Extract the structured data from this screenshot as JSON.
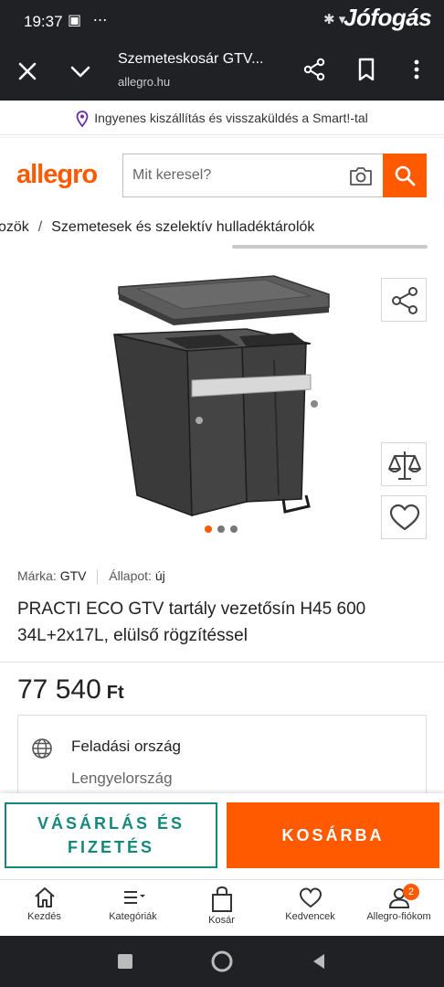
{
  "status_bar": {
    "time": "19:37",
    "left_icons": "▣ ⋯",
    "right_icons": "✱ ▾",
    "watermark": "Jófogás"
  },
  "browser": {
    "title": "Szemeteskosár GTV...",
    "url": "allegro.hu"
  },
  "promo": {
    "text": "Ingyenes kiszállítás és visszaküldés a Smart!-tal"
  },
  "header": {
    "logo": "allegro",
    "search_placeholder": "Mit keresel?"
  },
  "breadcrumb": {
    "items": [
      "ozök",
      "Szemetesek és szelektív hulladéktárolók"
    ]
  },
  "gallery": {
    "image_count": 3,
    "active_index": 0
  },
  "product": {
    "brand_label": "Márka:",
    "brand_value": "GTV",
    "condition_label": "Állapot:",
    "condition_value": "új",
    "title": "PRACTI ECO GTV tartály vezetősín H45 600 34L+2x17L, elülső rögzítéssel",
    "price": "77 540",
    "currency": "Ft",
    "origin_label": "Feladási ország",
    "origin_value": "Lengyelország"
  },
  "actions": {
    "buy_line1": "VÁSÁRLÁS ÉS",
    "buy_line2": "FIZETÉS",
    "cart": "KOSÁRBA"
  },
  "bottom_nav": {
    "items": [
      {
        "label": "Kezdés",
        "icon": "home-icon"
      },
      {
        "label": "Kategóriák",
        "icon": "list-icon"
      },
      {
        "label": "Kosár",
        "icon": "bag-icon"
      },
      {
        "label": "Kedvencek",
        "icon": "heart-icon"
      },
      {
        "label": "Allegro-fiókom",
        "icon": "user-icon"
      }
    ],
    "badge": "2"
  },
  "colors": {
    "accent": "#ff5a00",
    "teal": "#14897b",
    "dark": "#202124"
  }
}
